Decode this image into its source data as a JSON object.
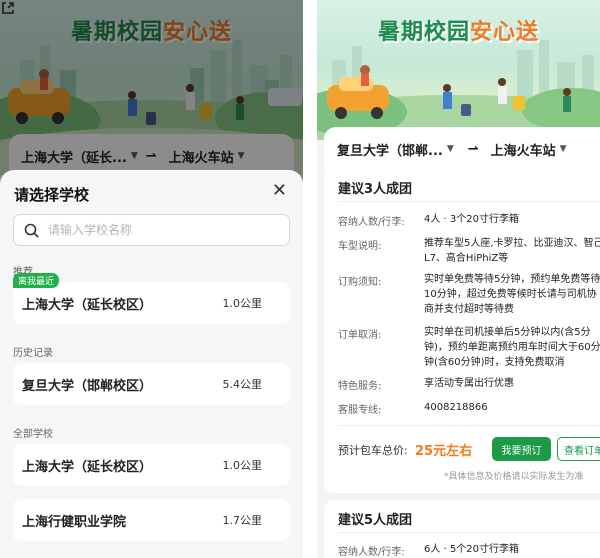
{
  "colors": {
    "primary_green": "#1c9a45",
    "price_orange": "#f27a1a",
    "banner_title_green": "#1e8a4d",
    "banner_title_orange": "#f07a24"
  },
  "banner": {
    "title_part1": "暑期校园",
    "title_part2": "安心送",
    "share_icon": "share-icon"
  },
  "left": {
    "route": {
      "from": "上海大学（延长...",
      "to": "上海火车站"
    },
    "sheet": {
      "title": "请选择学校",
      "close_icon": "close-icon",
      "search_placeholder": "请输入学校名称",
      "sections": [
        {
          "label": "推荐",
          "items": [
            {
              "badge": "离我最近",
              "name": "上海大学（延长校区）",
              "distance": "1.0公里"
            }
          ]
        },
        {
          "label": "历史记录",
          "items": [
            {
              "name": "复旦大学（邯郸校区）",
              "distance": "5.4公里"
            }
          ]
        },
        {
          "label": "全部学校",
          "items": [
            {
              "name": "上海大学（延长校区）",
              "distance": "1.0公里"
            },
            {
              "name": "上海行健职业学院",
              "distance": "1.7公里"
            }
          ]
        }
      ]
    }
  },
  "right": {
    "route": {
      "from": "复旦大学（邯郸...",
      "to": "上海火车站"
    },
    "cards": [
      {
        "title": "建议3人成团",
        "rows": [
          {
            "label": "容纳人数/行李:",
            "value": "4人 · 3个20寸行李箱"
          },
          {
            "label": "车型说明:",
            "value": "推荐车型5人座,卡罗拉、比亚迪汉、智己L7、高合HiPhiZ等"
          },
          {
            "label": "订购须知:",
            "value": "实时单免费等待5分钟，预约单免费等待10分钟，超过免费等候时长请与司机协商并支付超时等待费"
          },
          {
            "label": "订单取消:",
            "value": "实时单在司机接单后5分钟以内(含5分钟)，预约单距离预约用车时间大于60分钟(含60分钟)时，支持免费取消"
          },
          {
            "label": "特色服务:",
            "value": "享活动专属出行优惠"
          },
          {
            "label": "客服专线:",
            "value": "4008218866"
          }
        ],
        "price_label": "预计包车总价:",
        "price_value": "25元左右",
        "book_label": "我要预订",
        "order_label": "查看订单",
        "note": "*具体信息及价格请以实际发生为准"
      },
      {
        "title": "建议5人成团",
        "rows": [
          {
            "label": "容纳人数/行李:",
            "value": "6人 · 5个20寸行李箱"
          }
        ]
      }
    ]
  }
}
